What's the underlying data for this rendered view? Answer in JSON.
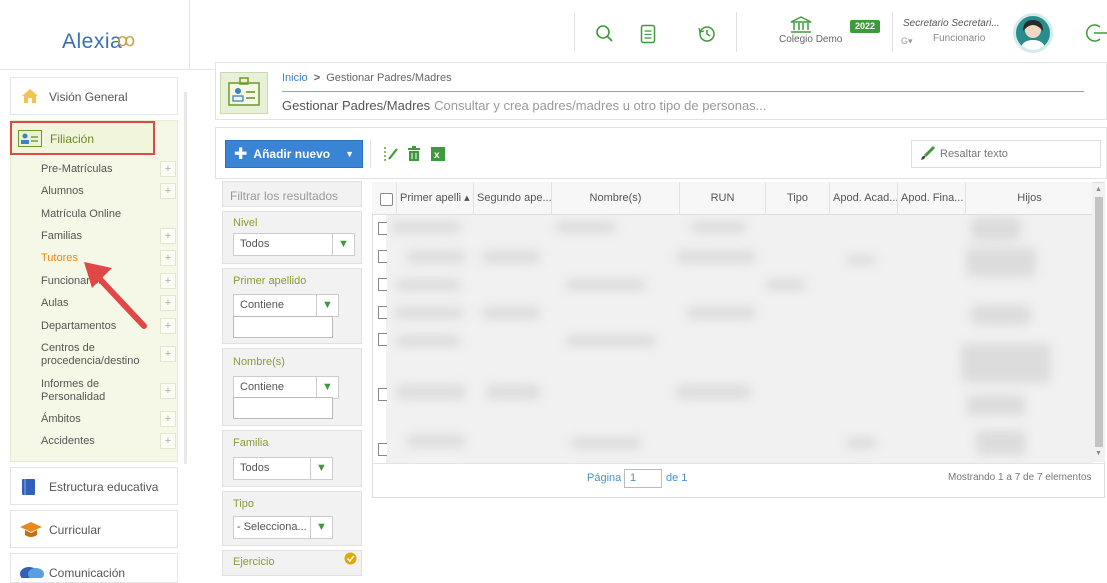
{
  "app": {
    "logo_text": "Alexia",
    "logo_mark": "ꝏ"
  },
  "topbar": {
    "icons": [
      "search-icon",
      "notes-icon",
      "history-icon",
      "school-icon",
      "logout-icon"
    ],
    "school": "Colegio Demo",
    "year": "2022",
    "user_name": "Secretario Secretari...",
    "user_role": "Funcionario",
    "user_menu": "G▾"
  },
  "sidebar": {
    "cards": [
      {
        "label": "Visión General",
        "icon": "home-icon"
      },
      {
        "label": "Filiación",
        "icon": "id-card-icon"
      },
      {
        "label": "Estructura educativa",
        "icon": "book-icon"
      },
      {
        "label": "Curricular",
        "icon": "graduation-cap-icon"
      },
      {
        "label": "Comunicación",
        "icon": "chat-icon"
      }
    ],
    "sub_items": [
      {
        "label": "Pre-Matrículas",
        "plus": true
      },
      {
        "label": "Alumnos",
        "plus": true
      },
      {
        "label": "Matrícula Online",
        "plus": false
      },
      {
        "label": "Familias",
        "plus": true
      },
      {
        "label": "Tutores",
        "plus": true,
        "active": true
      },
      {
        "label": "Funcionarios",
        "plus": true
      },
      {
        "label": "Aulas",
        "plus": true
      },
      {
        "label": "Departamentos",
        "plus": true
      },
      {
        "label": "Centros de procedencia/destino",
        "plus": true
      },
      {
        "label": "Informes de Personalidad",
        "plus": true
      },
      {
        "label": "Ámbitos",
        "plus": true
      },
      {
        "label": "Accidentes",
        "plus": true
      }
    ]
  },
  "header": {
    "breadcrumb_home": "Inicio",
    "breadcrumb_sep": ">",
    "breadcrumb_current": "Gestionar Padres/Madres",
    "title": "Gestionar Padres/Madres",
    "description": "Consultar y crea padres/madres u otro tipo de personas..."
  },
  "toolbar": {
    "add_label": "Añadir nuevo",
    "highlight_label": "Resaltar texto"
  },
  "filters": {
    "heading": "Filtrar los resultados",
    "nivel_label": "Nivel",
    "nivel_value": "Todos",
    "primer_label": "Primer apellido",
    "primer_value": "Contiene",
    "nombre_label": "Nombre(s)",
    "nombre_value": "Contiene",
    "familia_label": "Familia",
    "familia_value": "Todos",
    "tipo_label": "Tipo",
    "tipo_value": "- Selecciona...",
    "ejercicio_label": "Ejercicio"
  },
  "grid": {
    "columns": [
      "Primer apelli ▴",
      "Segundo ape...",
      "Nombre(s)",
      "RUN",
      "Tipo",
      "Apod. Acad...",
      "Apod. Fina...",
      "Hijos"
    ],
    "page_label": "Página",
    "page_value": "1",
    "page_of": "de 1",
    "count": "Mostrando 1 a 7 de 7 elementos"
  },
  "colors": {
    "accent": "#3a84d6",
    "green": "#8dbb4c",
    "highlight_red": "#e04848",
    "active_item": "#e8891e"
  }
}
